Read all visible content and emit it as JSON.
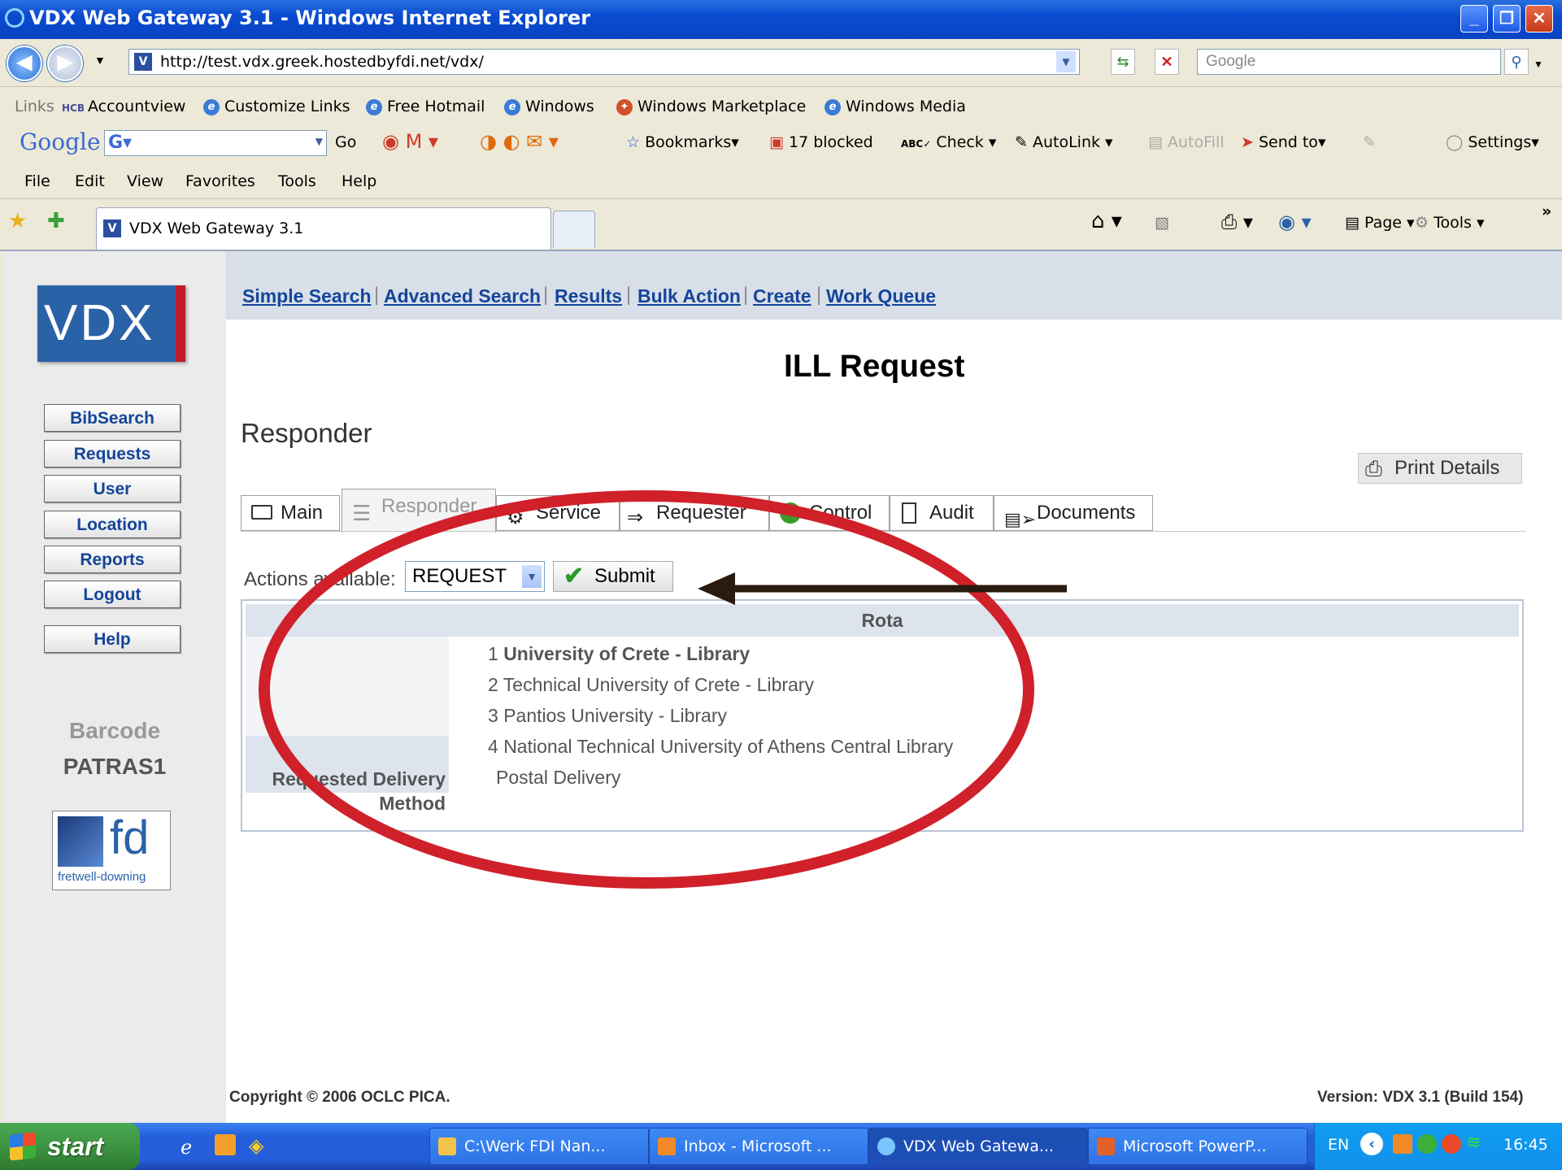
{
  "window": {
    "title": "VDX Web Gateway 3.1 - Windows Internet Explorer"
  },
  "address": {
    "url": "http://test.vdx.greek.hostedbyfdi.net/vdx/",
    "search_placeholder": "Google"
  },
  "links_bar": {
    "label": "Links",
    "items": [
      "Accountview",
      "Customize Links",
      "Free Hotmail",
      "Windows",
      "Windows Marketplace",
      "Windows Media"
    ]
  },
  "google_toolbar": {
    "logo": "Google",
    "go": "Go",
    "bookmarks": "Bookmarks",
    "blocked": "17 blocked",
    "check": "Check",
    "autolink": "AutoLink",
    "autofill": "AutoFill",
    "send_to": "Send to",
    "settings": "Settings"
  },
  "menu": [
    "File",
    "Edit",
    "View",
    "Favorites",
    "Tools",
    "Help"
  ],
  "browser_tab": {
    "title": "VDX Web Gateway 3.1",
    "page_btn": "Page",
    "tools_btn": "Tools"
  },
  "vdx": {
    "logo": "VDX",
    "top_nav": [
      "Simple Search",
      "Advanced Search",
      "Results",
      "Bulk Action",
      "Create",
      "Work Queue"
    ],
    "side_nav": [
      "BibSearch",
      "Requests",
      "User",
      "Location",
      "Reports",
      "Logout",
      "Help"
    ],
    "barcode_label": "Barcode",
    "barcode_value": "PATRAS1",
    "fd_logo_text": "fd",
    "fd_logo_sub": "fretwell-downing",
    "page_title": "ILL Request",
    "section_heading": "Responder",
    "print_details": "Print Details",
    "tabs": [
      "Main",
      "Responder",
      "Service",
      "Requester",
      "Control",
      "Audit",
      "Documents"
    ],
    "active_tab": "Responder",
    "actions_label": "Actions available:",
    "action_selected": "REQUEST",
    "submit_label": "Submit",
    "rota_header": "Rota",
    "rota": [
      {
        "num": "1",
        "name": "University of Crete - Library",
        "bold": true
      },
      {
        "num": "2",
        "name": "Technical University of Crete - Library",
        "bold": false
      },
      {
        "num": "3",
        "name": "Pantios University - Library",
        "bold": false
      },
      {
        "num": "4",
        "name": "National Technical University of Athens Central Library",
        "bold": false
      }
    ],
    "delivery_label": "Requested Delivery Method",
    "delivery_value": "Postal Delivery",
    "copyright": "Copyright © 2006 OCLC PICA.",
    "version": "Version: VDX 3.1 (Build 154)"
  },
  "taskbar": {
    "start": "start",
    "tasks": [
      "C:\\Werk FDI Nan...",
      "Inbox - Microsoft ...",
      "VDX Web Gatewa...",
      "Microsoft PowerP..."
    ],
    "language": "EN",
    "clock": "16:45"
  },
  "colors": {
    "annotation_red": "#d0202a",
    "link_blue": "#14459a",
    "vdx_blue": "#2a62a8"
  }
}
